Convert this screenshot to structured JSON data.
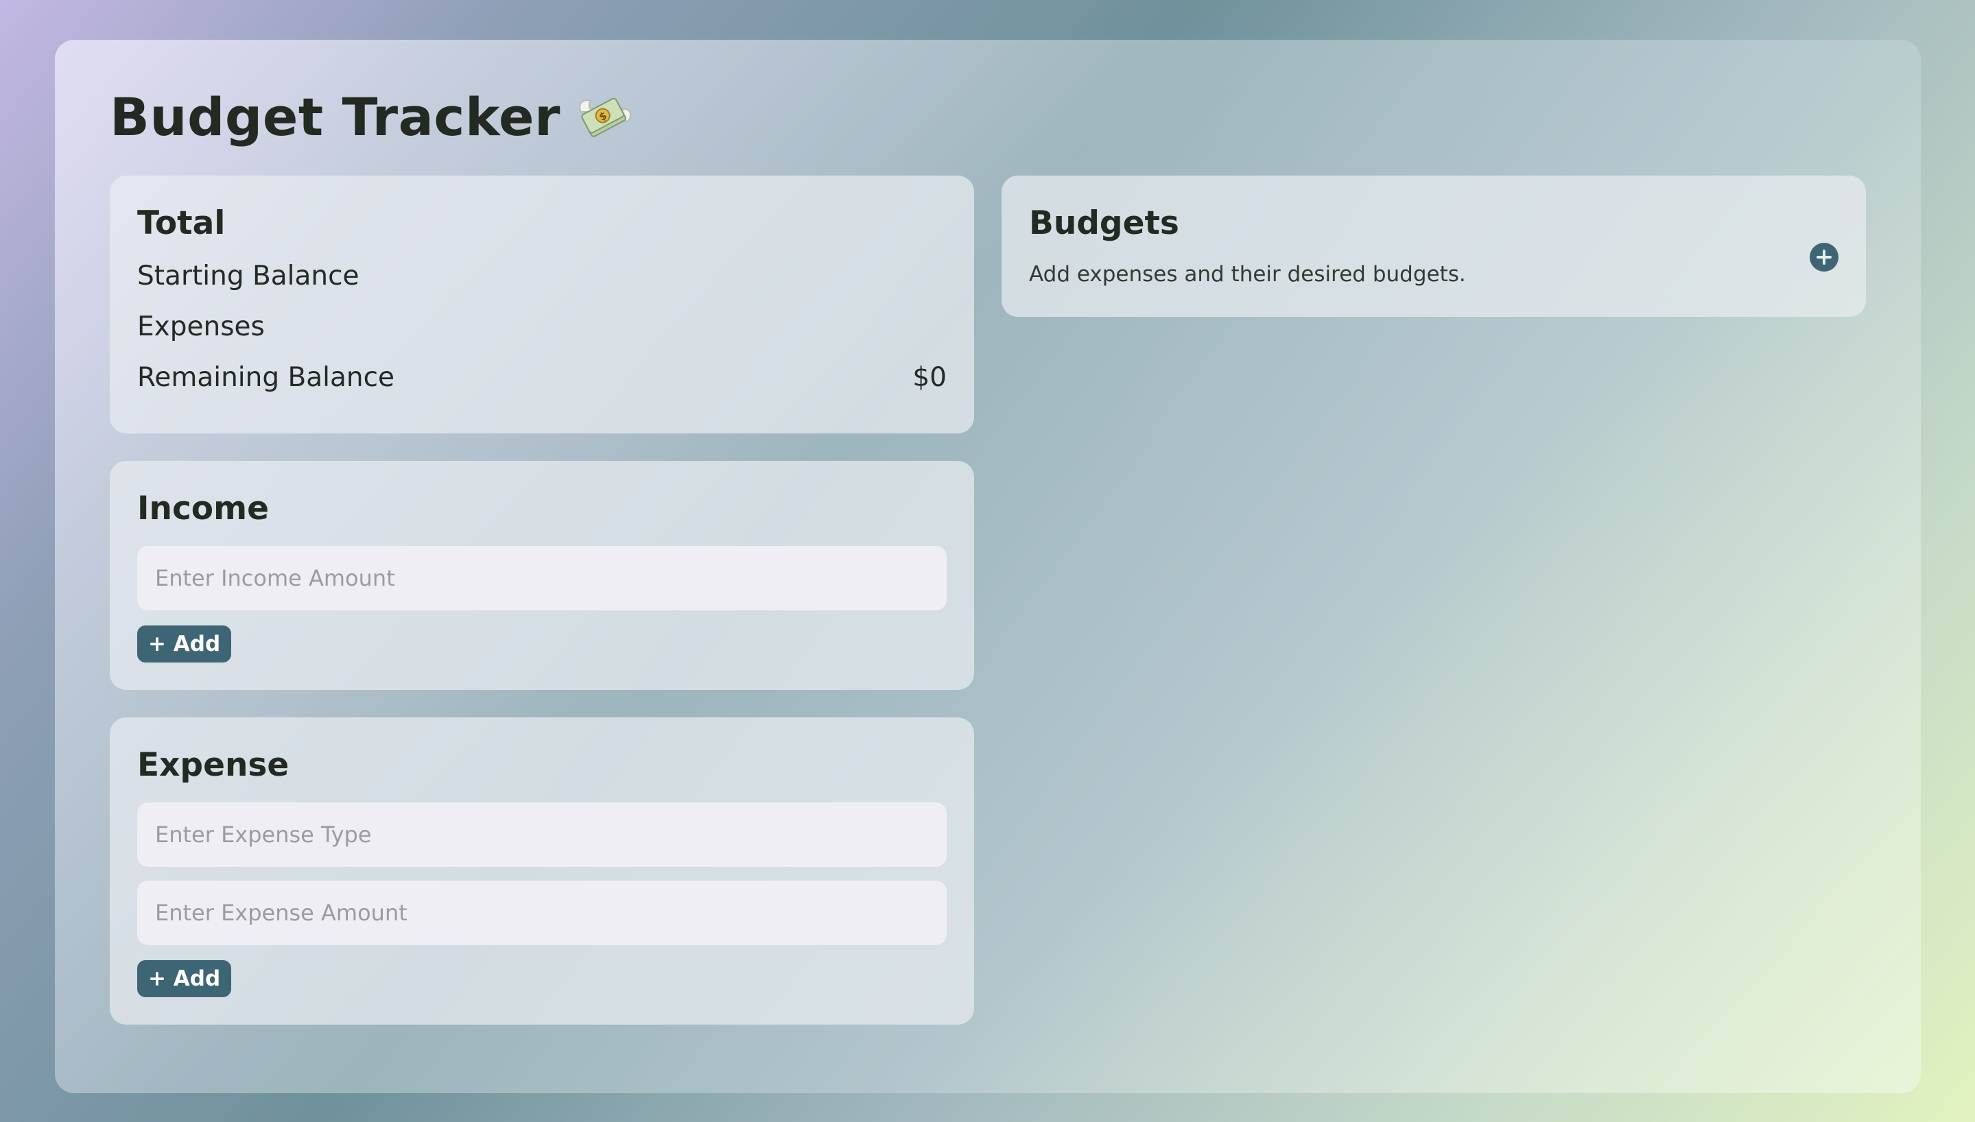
{
  "app": {
    "title": "Budget Tracker",
    "title_icon": "money-with-wings-icon"
  },
  "total": {
    "heading": "Total",
    "starting_balance_label": "Starting Balance",
    "expenses_label": "Expenses",
    "remaining_balance_label": "Remaining Balance",
    "remaining_balance_value": "$0"
  },
  "income": {
    "heading": "Income",
    "amount_placeholder": "Enter Income Amount",
    "add_label": "+ Add"
  },
  "expense": {
    "heading": "Expense",
    "type_placeholder": "Enter Expense Type",
    "amount_placeholder": "Enter Expense Amount",
    "add_label": "+ Add"
  },
  "budgets": {
    "heading": "Budgets",
    "description": "Add expenses and their desired budgets.",
    "add_icon": "plus-circle-icon"
  },
  "colors": {
    "accent": "#3d6574",
    "text": "#232a22",
    "card": "#e7ecf0",
    "input": "#efeef5"
  }
}
